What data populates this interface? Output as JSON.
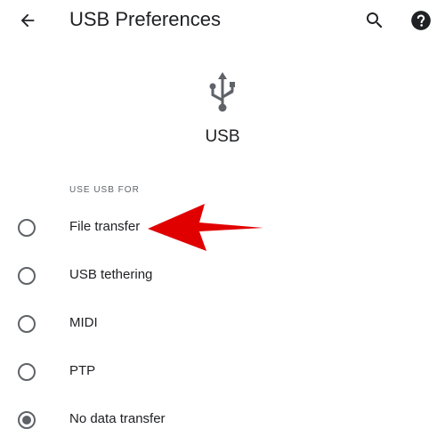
{
  "header": {
    "title": "USB Preferences",
    "back_icon": "arrow-back-icon",
    "search_icon": "search-icon",
    "help_icon": "help-icon"
  },
  "hero": {
    "icon": "usb-icon",
    "label": "USB"
  },
  "section": {
    "header": "USE USB FOR",
    "options": [
      {
        "label": "File transfer",
        "selected": false
      },
      {
        "label": "USB tethering",
        "selected": false
      },
      {
        "label": "MIDI",
        "selected": false
      },
      {
        "label": "PTP",
        "selected": false
      },
      {
        "label": "No data transfer",
        "selected": true
      }
    ]
  },
  "annotation": {
    "arrow_color": "#e00000"
  },
  "colors": {
    "text_primary": "#202124",
    "text_secondary": "#5f6368",
    "icon": "#5f6368"
  }
}
